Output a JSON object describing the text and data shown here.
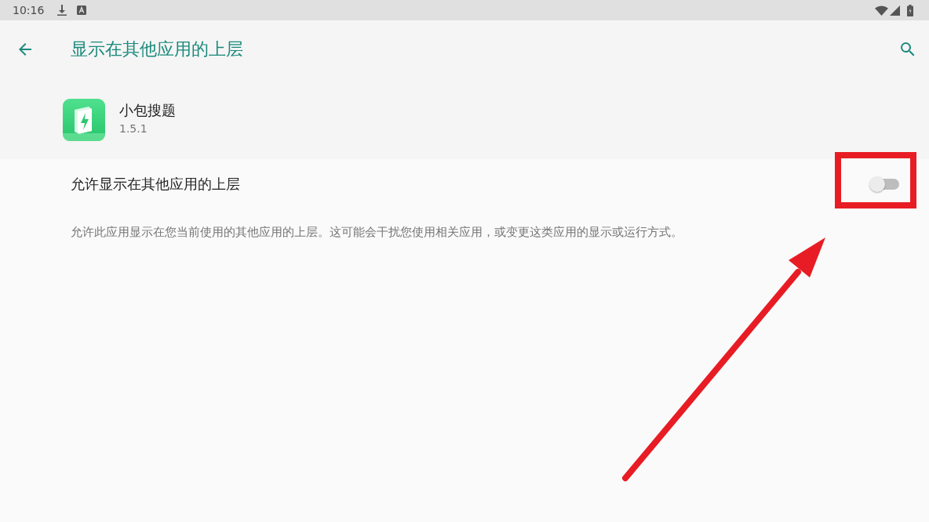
{
  "status_bar": {
    "time": "10:16"
  },
  "app_bar": {
    "title": "显示在其他应用的上层"
  },
  "app_info": {
    "name": "小包搜题",
    "version": "1.5.1"
  },
  "setting": {
    "label": "允许显示在其他应用的上层",
    "on": false
  },
  "description": "允许此应用显示在您当前使用的其他应用的上层。这可能会干扰您使用相关应用，或变更这类应用的显示或运行方式。"
}
